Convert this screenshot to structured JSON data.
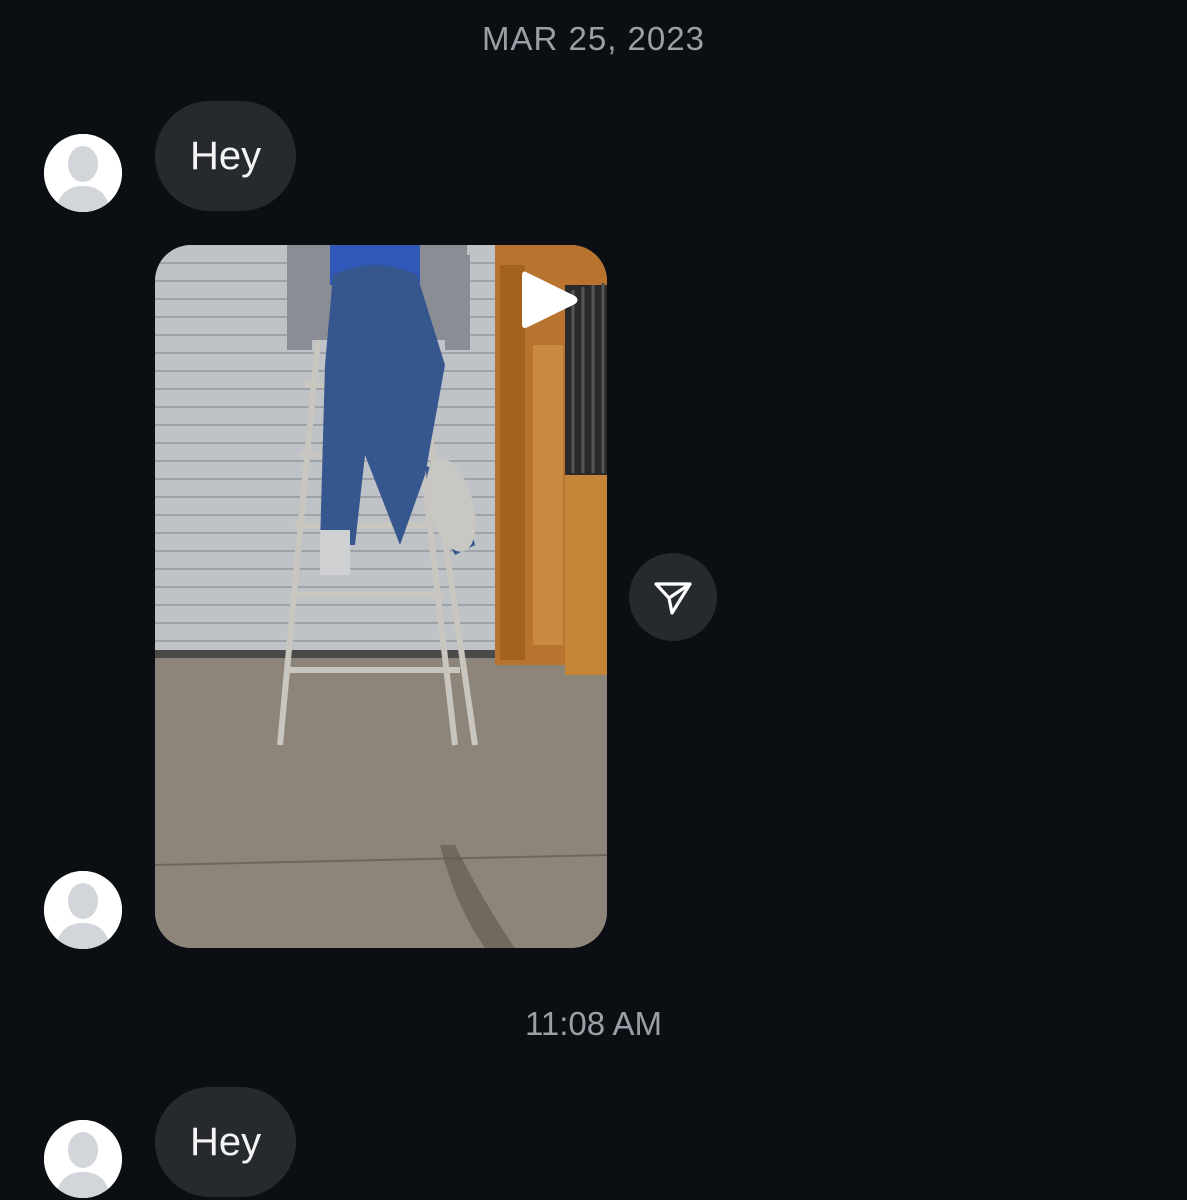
{
  "conversation": {
    "date_separator": "MAR 25, 2023",
    "time_separator": "11:08 AM",
    "messages": [
      {
        "type": "text",
        "text": "Hey"
      },
      {
        "type": "video"
      },
      {
        "type": "text",
        "text": "Hey"
      }
    ]
  },
  "icons": {
    "avatar": "default-avatar-icon",
    "play": "play-icon",
    "share": "send-icon"
  },
  "colors": {
    "background": "#0b0f14",
    "bubble": "#262a2f",
    "separator_text": "#9b9fa6",
    "message_text": "#f4f4f4"
  }
}
